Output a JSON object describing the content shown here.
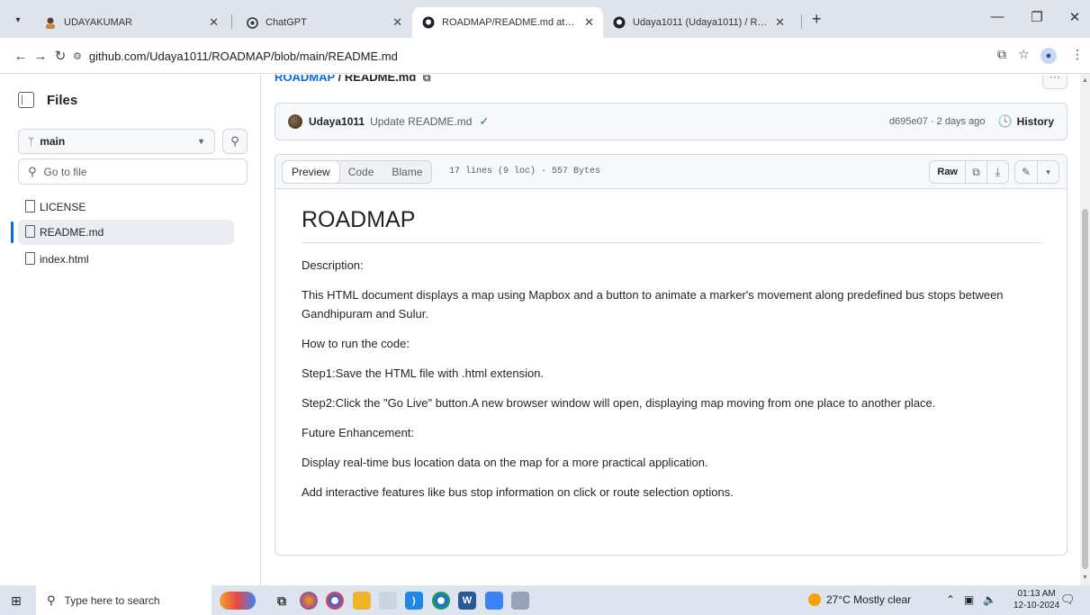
{
  "browser": {
    "tabs": [
      {
        "title": "UDAYAKUMAR",
        "active": false
      },
      {
        "title": "ChatGPT",
        "active": false
      },
      {
        "title": "ROADMAP/README.md at main",
        "active": true
      },
      {
        "title": "Udaya1011 (Udaya1011) / Repo",
        "active": false
      }
    ],
    "new_tab": "+",
    "url": "github.com/Udaya1011/ROADMAP/blob/main/README.md"
  },
  "sidebar": {
    "title": "Files",
    "branch": "main",
    "search_placeholder": "Go to file",
    "files": [
      {
        "name": "LICENSE",
        "selected": false
      },
      {
        "name": "README.md",
        "selected": true
      },
      {
        "name": "index.html",
        "selected": false
      }
    ]
  },
  "breadcrumb": {
    "repo": "ROADMAP",
    "separator": "/",
    "file": "README.md"
  },
  "commit": {
    "author": "Udaya1011",
    "message": "Update README.md",
    "meta": "d695e07 · 2 days ago",
    "history_label": "History"
  },
  "file_header": {
    "tabs": [
      "Preview",
      "Code",
      "Blame"
    ],
    "active_tab": "Preview",
    "info": "17 lines (9 loc) · 557 Bytes",
    "raw_label": "Raw"
  },
  "readme": {
    "title": "ROADMAP",
    "paragraphs": [
      "Description:",
      "This HTML document displays a map using Mapbox and a button to animate a marker's movement along predefined bus stops between Gandhipuram and Sulur.",
      "How to run the code:",
      "Step1:Save the HTML file with .html extension.",
      "Step2:Click the \"Go Live\" button.A new browser window will open, displaying map moving from one place to another place.",
      "Future Enhancement:",
      "Display real-time bus location data on the map for a more practical application.",
      "Add interactive features like bus stop information on click or route selection options."
    ]
  },
  "taskbar": {
    "search_placeholder": "Type here to search",
    "weather": "27°C  Mostly clear",
    "time": "01:13 AM",
    "date": "12-10-2024"
  },
  "colors": {
    "link": "#0969da",
    "border": "#d0d7de",
    "success": "#1a7f37",
    "tabstrip": "#dfe3eb"
  }
}
